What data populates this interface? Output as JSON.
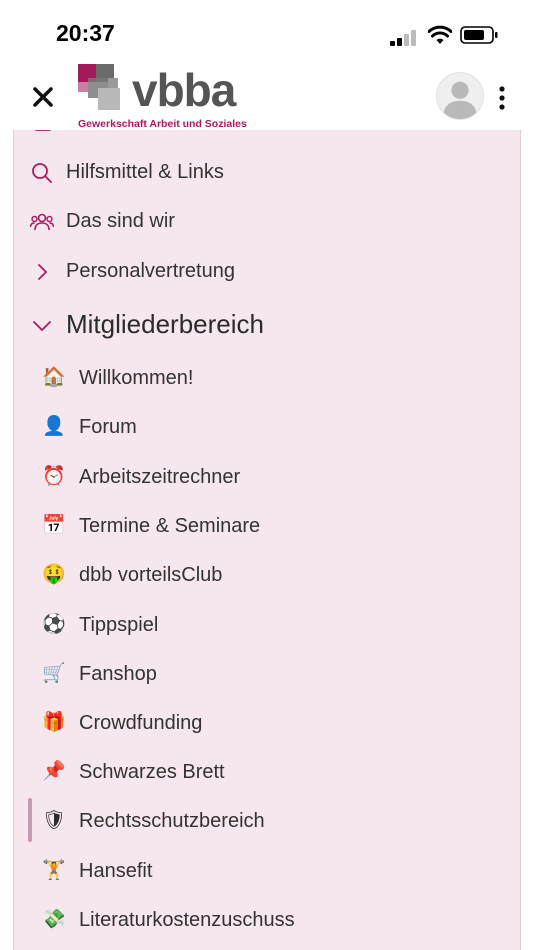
{
  "status": {
    "time": "20:37"
  },
  "header": {
    "logo_word": "vbba",
    "logo_sub": "Gewerkschaft Arbeit und Soziales"
  },
  "menu": {
    "top_items": [
      {
        "label": "Hilfsmittel & Links",
        "icon": "search-icon"
      },
      {
        "label": "Das sind wir",
        "icon": "people-icon"
      },
      {
        "label": "Personalvertretung",
        "icon": "chevron-right-icon"
      }
    ],
    "section": {
      "label": "Mitgliederbereich",
      "icon": "chevron-down-icon"
    },
    "sub_items": [
      {
        "label": "Willkommen!",
        "icon": "house-icon",
        "glyph": "🏠"
      },
      {
        "label": "Forum",
        "icon": "person-silhouette-icon",
        "glyph": "👤"
      },
      {
        "label": "Arbeitszeitrechner",
        "icon": "alarm-clock-icon",
        "glyph": "⏰"
      },
      {
        "label": "Termine & Seminare",
        "icon": "calendar-icon",
        "glyph": "📅"
      },
      {
        "label": "dbb vorteilsClub",
        "icon": "money-face-icon",
        "glyph": "🤑"
      },
      {
        "label": "Tippspiel",
        "icon": "soccer-ball-icon",
        "glyph": "⚽"
      },
      {
        "label": "Fanshop",
        "icon": "shopping-cart-icon",
        "glyph": "🛒"
      },
      {
        "label": "Crowdfunding",
        "icon": "gift-icon",
        "glyph": "🎁"
      },
      {
        "label": "Schwarzes Brett",
        "icon": "pushpin-icon",
        "glyph": "📌"
      },
      {
        "label": "Rechtsschutzbereich",
        "icon": "shield-icon",
        "glyph": "🛡"
      },
      {
        "label": "Hansefit",
        "icon": "weightlifter-icon",
        "glyph": "🏋"
      },
      {
        "label": "Literaturkostenzuschuss",
        "icon": "money-wings-icon",
        "glyph": "💸"
      }
    ]
  },
  "colors": {
    "accent": "#b0185f",
    "panel_bg": "#f6e6ee",
    "active_bar": "#c79ab1"
  }
}
